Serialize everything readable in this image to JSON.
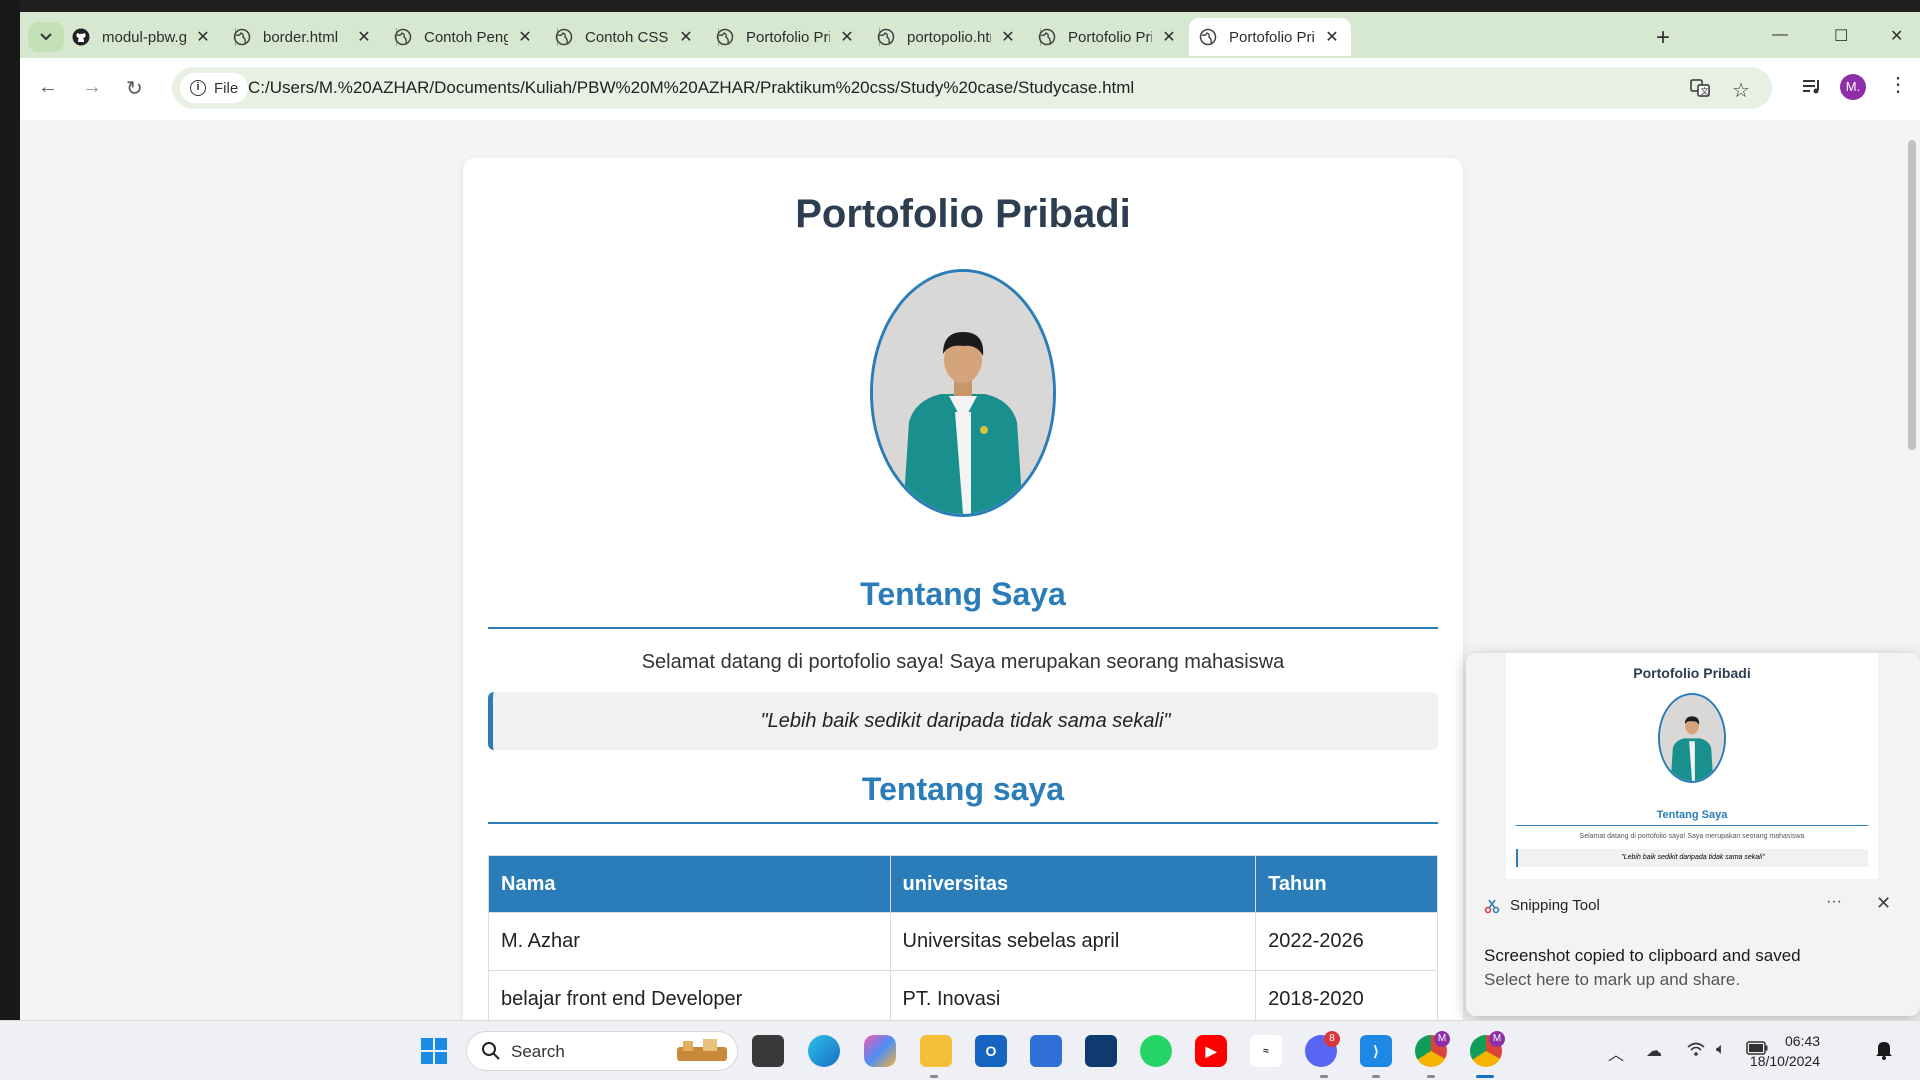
{
  "browser": {
    "tabs": [
      {
        "title": "modul-pbw.gith",
        "icon": "github-icon",
        "active": false
      },
      {
        "title": "border.html",
        "icon": "globe-icon",
        "active": false
      },
      {
        "title": "Contoh Penggu",
        "icon": "globe-icon",
        "active": false
      },
      {
        "title": "Contoh CSS Pro",
        "icon": "globe-icon",
        "active": false
      },
      {
        "title": "Portofolio Priba",
        "icon": "globe-icon",
        "active": false
      },
      {
        "title": "portopolio.html",
        "icon": "globe-icon",
        "active": false
      },
      {
        "title": "Portofolio Priba",
        "icon": "globe-icon",
        "active": false
      },
      {
        "title": "Portofolio Priba",
        "icon": "globe-icon",
        "active": true
      }
    ],
    "address": {
      "scheme_label": "File",
      "url": "C:/Users/M.%20AZHAR/Documents/Kuliah/PBW%20M%20AZHAR/Praktikum%20css/Study%20case/Studycase.html"
    },
    "profile_initial": "M."
  },
  "page": {
    "title": "Portofolio Pribadi",
    "section1_heading": "Tentang Saya",
    "intro": "Selamat datang di portofolio saya! Saya merupakan seorang mahasiswa",
    "quote": "\"Lebih baik sedikit daripada tidak sama sekali\"",
    "section2_heading": "Tentang saya",
    "table": {
      "headers": [
        "Nama",
        "universitas",
        "Tahun"
      ],
      "rows": [
        [
          "M. Azhar",
          "Universitas sebelas april",
          "2022-2026"
        ],
        [
          "belajar front end Developer",
          "PT. Inovasi",
          "2018-2020"
        ]
      ]
    }
  },
  "snipping": {
    "app_name": "Snipping Tool",
    "message": "Screenshot copied to clipboard and saved",
    "sub": "Select here to mark up and share.",
    "thumb": {
      "title": "Portofolio Pribadi",
      "heading": "Tentang Saya",
      "intro": "Selamat datang di portofolio saya! Saya merupakan seorang mahasiswa",
      "quote": "\"Lebih baik sedikit daripada tidak sama sekali\""
    }
  },
  "taskbar": {
    "search_placeholder": "Search",
    "discord_badge": "8",
    "chrome_badge": "M",
    "clock_time": "06:43",
    "clock_date": "18/10/2024"
  },
  "colors": {
    "accent": "#2a7db8",
    "heading": "#2c3e50",
    "tabbar": "#d6e8d0"
  }
}
